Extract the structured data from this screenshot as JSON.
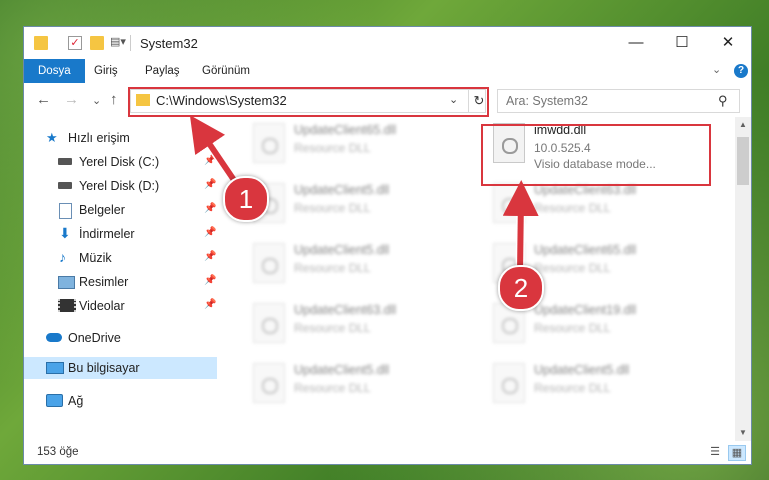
{
  "window": {
    "title": "System32",
    "controls": {
      "minimize": "—",
      "maximize": "☐",
      "close": "✕"
    }
  },
  "ribbon": {
    "tabs": [
      "Dosya",
      "Giriş",
      "Paylaş",
      "Görünüm"
    ],
    "collapse_glyph": "⌄",
    "help_glyph": "?"
  },
  "nav": {
    "back": "←",
    "forward": "→",
    "recent": "⌄",
    "up": "↑",
    "address": "C:\\Windows\\System32",
    "address_dropdown": "⌄",
    "refresh": "↻",
    "search_placeholder": "Ara: System32",
    "search_glyph": "⚲"
  },
  "sidebar": {
    "items": [
      {
        "label": "Hızlı erişim",
        "icon": "star-icon",
        "pinned": false
      },
      {
        "label": "Yerel Disk (C:)",
        "icon": "drive-icon",
        "pinned": true
      },
      {
        "label": "Yerel Disk (D:)",
        "icon": "drive-icon",
        "pinned": true
      },
      {
        "label": "Belgeler",
        "icon": "documents-icon",
        "pinned": true
      },
      {
        "label": "İndirmeler",
        "icon": "download-icon",
        "pinned": true
      },
      {
        "label": "Müzik",
        "icon": "music-icon",
        "pinned": true
      },
      {
        "label": "Resimler",
        "icon": "pictures-icon",
        "pinned": true
      },
      {
        "label": "Videolar",
        "icon": "videos-icon",
        "pinned": true
      },
      {
        "label": "OneDrive",
        "icon": "cloud-icon",
        "pinned": false
      },
      {
        "label": "Bu bilgisayar",
        "icon": "computer-icon",
        "pinned": false,
        "selected": true
      },
      {
        "label": "Ağ",
        "icon": "network-icon",
        "pinned": false
      }
    ],
    "pin_glyph": "📌"
  },
  "files": {
    "highlighted": {
      "name": "imwdd.dll",
      "version": "10.0.525.4",
      "description": "Visio database mode..."
    },
    "blurred": [
      {
        "name": "UpdateClient65.dll",
        "type": "Resource DLL"
      },
      {
        "name": "UpdateClient5.dll",
        "type": "Resource DLL"
      },
      {
        "name": "UpdateClient63.dll",
        "type": "Resource DLL"
      },
      {
        "name": "UpdateClient5.dll",
        "type": "Resource DLL"
      },
      {
        "name": "UpdateClient65.dll",
        "type": "Resource DLL"
      },
      {
        "name": "UpdateClient63.dll",
        "type": "Resource DLL"
      },
      {
        "name": "UpdateClient19.dll",
        "type": "Resource DLL"
      },
      {
        "name": "UpdateClient5.dll",
        "type": "Resource DLL"
      },
      {
        "name": "UpdateClient5.dll",
        "type": "Resource DLL"
      }
    ]
  },
  "status": {
    "item_count": "153 öğe"
  },
  "annotations": {
    "step1": "1",
    "step2": "2",
    "color": "#d9363e"
  },
  "colors": {
    "accent": "#1979ca",
    "selection": "#cce8ff"
  }
}
